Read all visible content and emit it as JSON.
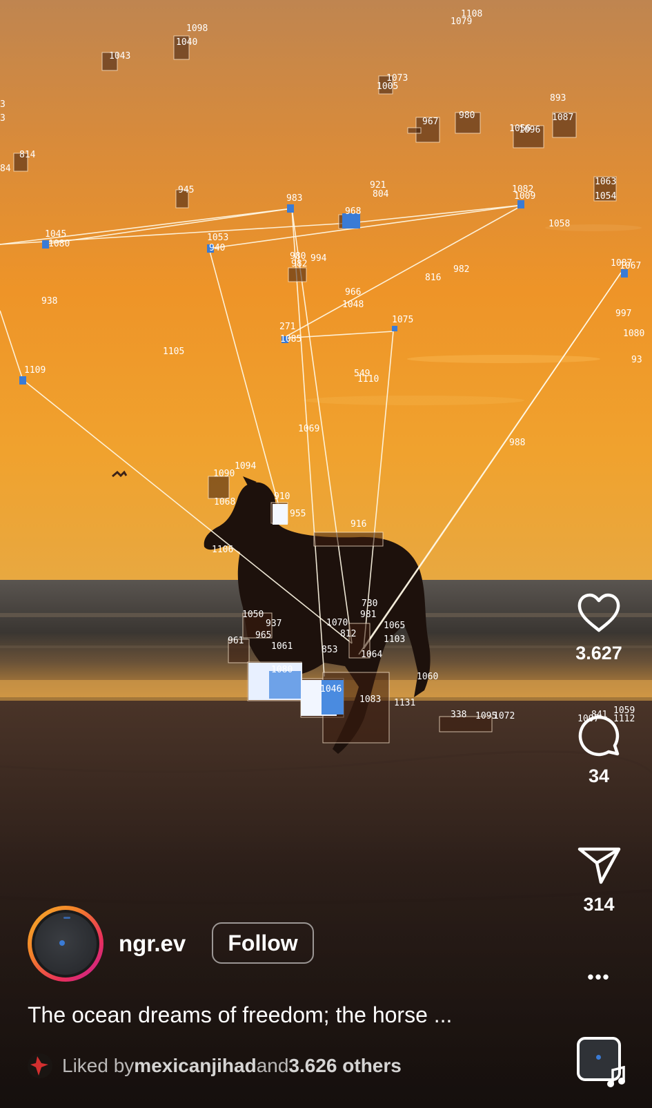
{
  "colors": {
    "sky_top": "#c98a4c",
    "sky_mid": "#ef9a2c",
    "horizon": "#f4a52e",
    "sea": "#4a4640",
    "sand": "#3a2820",
    "accent_ring_start": "#f4b02a",
    "accent_ring_end": "#d3208f",
    "text": "#ffffff"
  },
  "tracking_labels": [
    "1108",
    "1079",
    "1098",
    "1040",
    "1043",
    "1073",
    "1005",
    "893",
    "1087",
    "967",
    "980",
    "1056",
    "814",
    "945",
    "921",
    "804",
    "1082",
    "1009",
    "1063",
    "1054",
    "983",
    "968",
    "1058",
    "1045",
    "1080",
    "1053",
    "940",
    "980",
    "982",
    "994",
    "816",
    "982",
    "1087",
    "938",
    "966",
    "1048",
    "271",
    "1085",
    "1075",
    "997",
    "1080",
    "1105",
    "1109",
    "549",
    "1110",
    "1069",
    "988",
    "1090",
    "1094",
    "910",
    "1068",
    "955",
    "916",
    "1106",
    "730",
    "981",
    "1050",
    "937",
    "1070",
    "1065",
    "961",
    "965",
    "812",
    "1103",
    "1061",
    "853",
    "1064",
    "1080",
    "1046",
    "1060",
    "1083",
    "1131",
    "338",
    "1095",
    "1072",
    "1059",
    "1112",
    "1007",
    "841",
    "93",
    "3",
    "3",
    "84",
    "1096",
    "1067"
  ],
  "actions": {
    "like_count": "3.627",
    "comment_count": "34",
    "share_count": "314",
    "more": "•••"
  },
  "post": {
    "username": "ngr.ev",
    "follow_label": "Follow",
    "caption": "The ocean dreams of freedom; the horse ...",
    "liked_prefix": "Liked by ",
    "liked_user": "mexicanjihad",
    "liked_and": " and ",
    "liked_others": "3.626 others"
  },
  "icons": {
    "like": "heart-icon",
    "comment": "comment-bubble-icon",
    "share": "paper-plane-icon",
    "more": "more-dots-icon",
    "audio": "music-note-icon"
  }
}
